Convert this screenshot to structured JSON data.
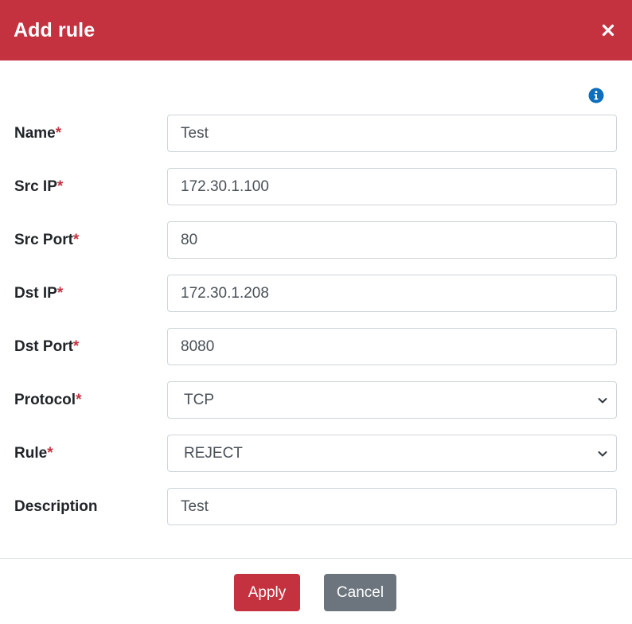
{
  "dialog": {
    "title": "Add rule",
    "accent_color": "#c43240",
    "info_icon": "info-circle-icon",
    "close_icon": "close-icon"
  },
  "form": {
    "required_marker": "*",
    "fields": [
      {
        "label": "Name",
        "required": true,
        "type": "text",
        "value": "Test"
      },
      {
        "label": "Src IP",
        "required": true,
        "type": "text",
        "value": "172.30.1.100"
      },
      {
        "label": "Src Port",
        "required": true,
        "type": "text",
        "value": "80"
      },
      {
        "label": "Dst IP",
        "required": true,
        "type": "text",
        "value": "172.30.1.208"
      },
      {
        "label": "Dst Port",
        "required": true,
        "type": "text",
        "value": "8080"
      },
      {
        "label": "Protocol",
        "required": true,
        "type": "select",
        "value": "TCP"
      },
      {
        "label": "Rule",
        "required": true,
        "type": "select",
        "value": "REJECT"
      },
      {
        "label": "Description",
        "required": false,
        "type": "text",
        "value": "Test"
      }
    ]
  },
  "footer": {
    "apply_label": "Apply",
    "cancel_label": "Cancel",
    "apply_color": "#c43240",
    "cancel_color": "#6c757d"
  }
}
